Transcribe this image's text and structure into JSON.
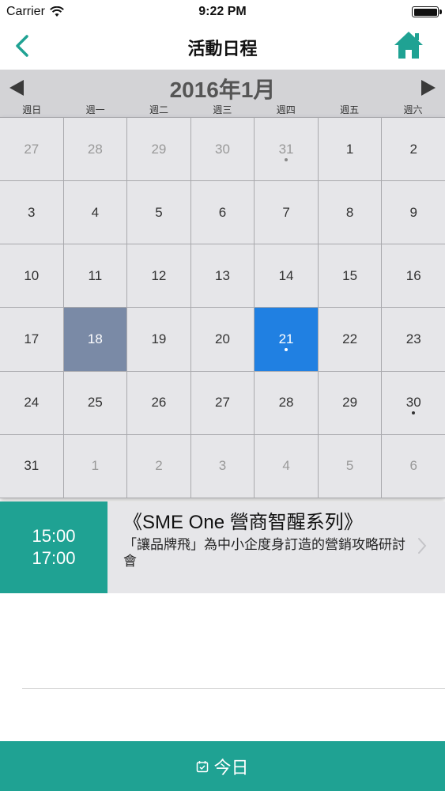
{
  "status_bar": {
    "carrier": "Carrier",
    "time": "9:22 PM"
  },
  "nav": {
    "title": "活動日程",
    "back_icon": "chevron-left-icon",
    "home_icon": "home-icon",
    "accent_color": "#1fa293"
  },
  "calendar": {
    "month_title": "2016年1月",
    "weekdays": [
      "週日",
      "週一",
      "週二",
      "週三",
      "週四",
      "週五",
      "週六"
    ],
    "selected_day": "18",
    "today": "21",
    "weeks": [
      [
        {
          "d": "27",
          "other": true
        },
        {
          "d": "28",
          "other": true
        },
        {
          "d": "29",
          "other": true
        },
        {
          "d": "30",
          "other": true
        },
        {
          "d": "31",
          "other": true,
          "dot": true
        },
        {
          "d": "1"
        },
        {
          "d": "2"
        }
      ],
      [
        {
          "d": "3"
        },
        {
          "d": "4"
        },
        {
          "d": "5"
        },
        {
          "d": "6"
        },
        {
          "d": "7"
        },
        {
          "d": "8"
        },
        {
          "d": "9"
        }
      ],
      [
        {
          "d": "10"
        },
        {
          "d": "11"
        },
        {
          "d": "12"
        },
        {
          "d": "13"
        },
        {
          "d": "14"
        },
        {
          "d": "15"
        },
        {
          "d": "16"
        }
      ],
      [
        {
          "d": "17"
        },
        {
          "d": "18",
          "selected": true
        },
        {
          "d": "19"
        },
        {
          "d": "20"
        },
        {
          "d": "21",
          "today": true,
          "dot": true
        },
        {
          "d": "22"
        },
        {
          "d": "23"
        }
      ],
      [
        {
          "d": "24"
        },
        {
          "d": "25"
        },
        {
          "d": "26"
        },
        {
          "d": "27"
        },
        {
          "d": "28"
        },
        {
          "d": "29"
        },
        {
          "d": "30",
          "dot": true
        }
      ],
      [
        {
          "d": "31"
        },
        {
          "d": "1",
          "other": true
        },
        {
          "d": "2",
          "other": true
        },
        {
          "d": "3",
          "other": true
        },
        {
          "d": "4",
          "other": true
        },
        {
          "d": "5",
          "other": true
        },
        {
          "d": "6",
          "other": true
        }
      ]
    ]
  },
  "event": {
    "start_time": "15:00",
    "end_time": "17:00",
    "title": "《SME One 營商智醒系列》",
    "description": "「讓品牌飛」為中小企度身訂造的營銷攻略研討會"
  },
  "today_button": {
    "label": "今日",
    "icon": "calendar-icon"
  }
}
